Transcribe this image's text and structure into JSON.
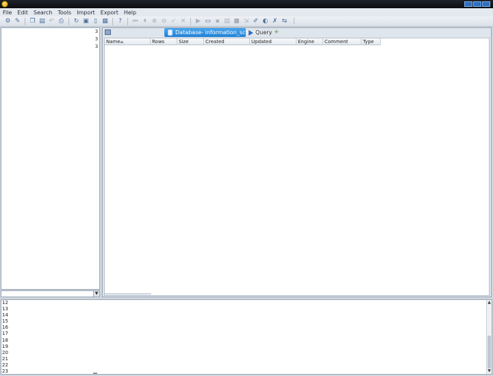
{
  "menu": {
    "items": [
      "File",
      "Edit",
      "Search",
      "Tools",
      "Import",
      "Export",
      "Help"
    ]
  },
  "toolbar": {
    "buttons": [
      {
        "icon": "connect-icon",
        "enabled": true
      },
      {
        "icon": "pen-icon",
        "enabled": true
      },
      {
        "icon": "copy-icon",
        "enabled": true
      },
      {
        "icon": "paste-icon",
        "enabled": true
      },
      {
        "icon": "undo-icon",
        "enabled": false
      },
      {
        "icon": "print-icon",
        "enabled": true
      },
      {
        "icon": "refresh-icon",
        "enabled": true
      },
      {
        "icon": "lock-icon",
        "enabled": true
      },
      {
        "icon": "new-document-icon",
        "enabled": true
      },
      {
        "icon": "table-icon",
        "enabled": true
      },
      {
        "icon": "help-icon",
        "enabled": true
      },
      {
        "icon": "first-record-icon",
        "enabled": false
      },
      {
        "icon": "prev-record-icon",
        "enabled": false
      },
      {
        "icon": "add-record-icon",
        "enabled": false
      },
      {
        "icon": "delete-record-icon",
        "enabled": false
      },
      {
        "icon": "commit-icon",
        "enabled": false
      },
      {
        "icon": "cancel-icon",
        "enabled": false
      },
      {
        "icon": "run-icon",
        "enabled": false
      },
      {
        "icon": "open-folder-icon",
        "enabled": true
      },
      {
        "icon": "save-icon",
        "enabled": false
      },
      {
        "icon": "save-as-icon",
        "enabled": false
      },
      {
        "icon": "briefcase-icon",
        "enabled": false
      },
      {
        "icon": "export-icon",
        "enabled": false
      },
      {
        "icon": "edit-icon",
        "enabled": true
      },
      {
        "icon": "highlight-icon",
        "enabled": true
      },
      {
        "icon": "clear-icon",
        "enabled": true
      },
      {
        "icon": "link-icon",
        "enabled": true
      },
      {
        "icon": "more-options-icon",
        "enabled": true
      }
    ]
  },
  "tree": {
    "scroll_marks": [
      "3",
      "3",
      "3"
    ]
  },
  "tabs": {
    "active_label": "Database- information_schema",
    "query_label": "Query"
  },
  "grid": {
    "columns": [
      {
        "label": "Name",
        "sorted": true
      },
      {
        "label": "Rows"
      },
      {
        "label": "Size"
      },
      {
        "label": "Created"
      },
      {
        "label": "Updated"
      },
      {
        "label": "Engine"
      },
      {
        "label": "Comment"
      },
      {
        "label": "Type"
      }
    ]
  },
  "log": {
    "line_numbers": [
      "12",
      "13",
      "14",
      "15",
      "16",
      "17",
      "18",
      "19",
      "20",
      "21",
      "22",
      "23"
    ]
  }
}
